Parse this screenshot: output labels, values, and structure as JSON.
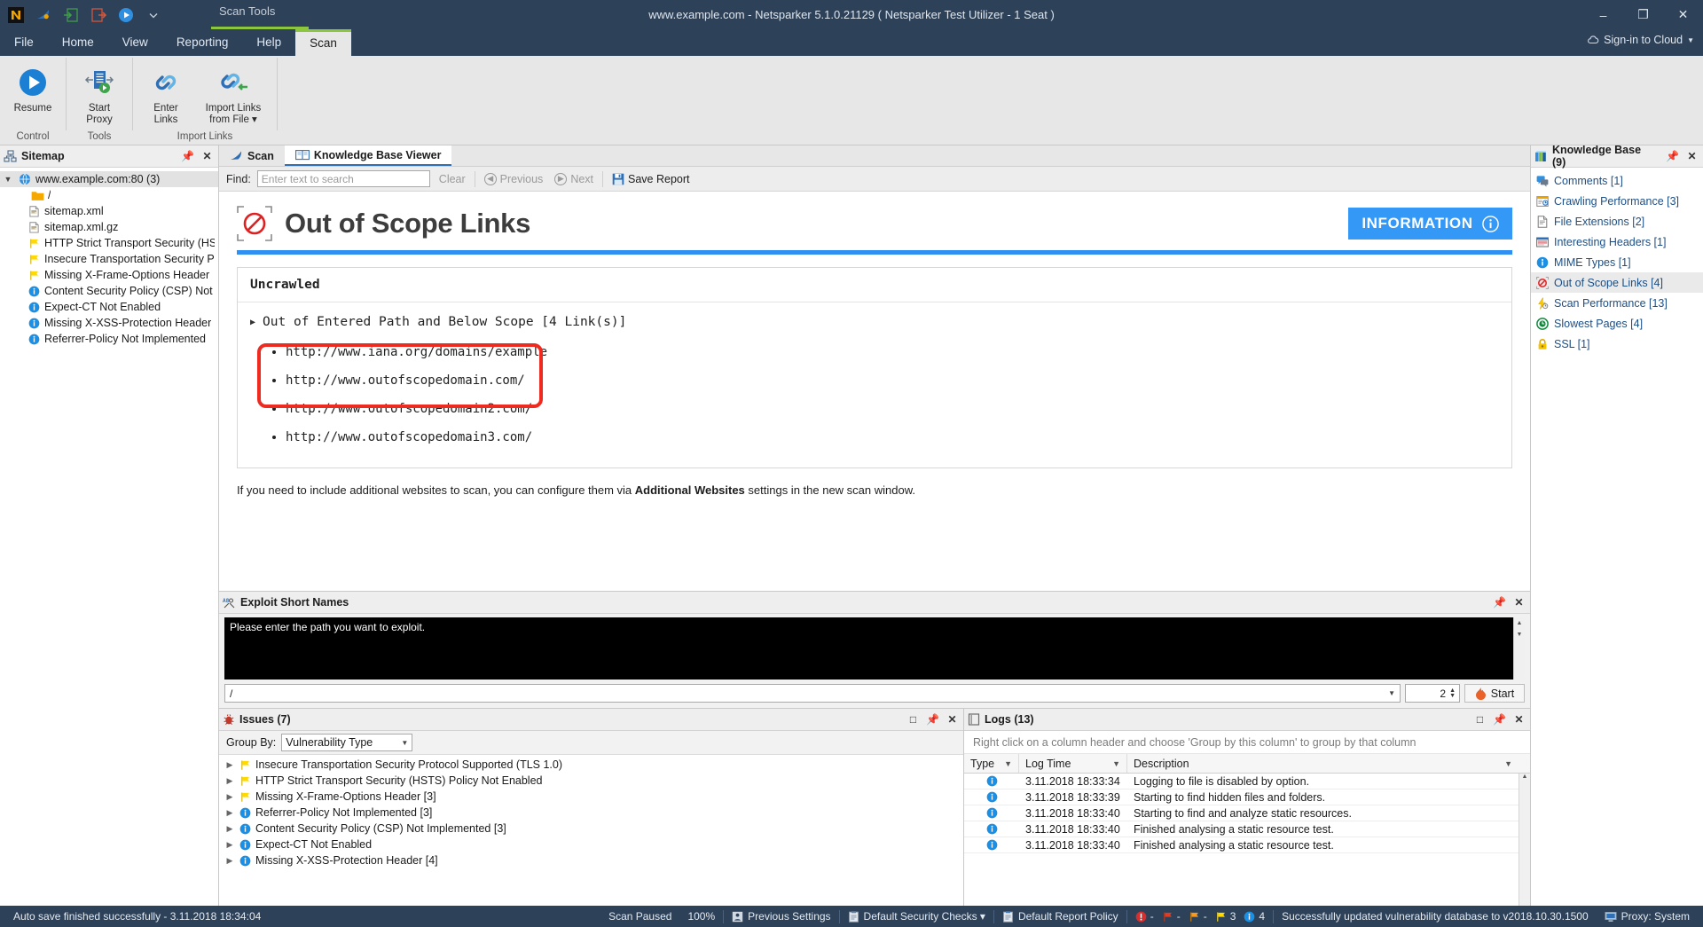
{
  "window": {
    "title": "www.example.com - Netsparker 5.1.0.21129  ( Netsparker Test Utilizer - 1 Seat )",
    "contextual_tab_group": "Scan Tools",
    "minimize": "–",
    "restore": "❐",
    "close": "✕",
    "cloud_signin": "Sign-in to Cloud"
  },
  "ribbon": {
    "tabs": [
      {
        "label": "File",
        "active": false
      },
      {
        "label": "Home",
        "active": false
      },
      {
        "label": "View",
        "active": false
      },
      {
        "label": "Reporting",
        "active": false
      },
      {
        "label": "Help",
        "active": false
      },
      {
        "label": "Scan",
        "active": true
      }
    ],
    "groups": [
      {
        "label": "Control",
        "buttons": [
          {
            "label": "Resume",
            "icon": "play-circle-icon"
          }
        ]
      },
      {
        "label": "Tools",
        "buttons": [
          {
            "label": "Start\nProxy",
            "icon": "proxy-icon"
          }
        ]
      },
      {
        "label": "Import Links",
        "buttons": [
          {
            "label": "Enter\nLinks",
            "icon": "chain-link-icon"
          },
          {
            "label": "Import Links\nfrom File ▾",
            "icon": "import-link-icon"
          }
        ]
      }
    ]
  },
  "sitemap": {
    "title": "Sitemap",
    "root": {
      "label": "www.example.com:80 (3)",
      "icon": "globe-icon"
    },
    "items": [
      {
        "label": "/",
        "icon": "folder-icon"
      },
      {
        "label": "sitemap.xml",
        "icon": "xml-file-icon"
      },
      {
        "label": "sitemap.xml.gz",
        "icon": "xml-file-icon"
      },
      {
        "label": "HTTP Strict Transport Security (HST",
        "icon": "flag-yellow-icon"
      },
      {
        "label": "Insecure Transportation Security Pr",
        "icon": "flag-yellow-icon"
      },
      {
        "label": "Missing X-Frame-Options Header",
        "icon": "flag-yellow-icon"
      },
      {
        "label": "Content Security Policy (CSP) Not I",
        "icon": "info-blue-icon"
      },
      {
        "label": "Expect-CT Not Enabled",
        "icon": "info-blue-icon"
      },
      {
        "label": "Missing X-XSS-Protection Header",
        "icon": "info-blue-icon"
      },
      {
        "label": "Referrer-Policy Not Implemented",
        "icon": "info-blue-icon"
      }
    ]
  },
  "doc_tabs": [
    {
      "label": "Scan",
      "icon": "shark-fin-icon",
      "active": false
    },
    {
      "label": "Knowledge Base Viewer",
      "icon": "book-icon",
      "active": true
    }
  ],
  "findbar": {
    "find_label": "Find:",
    "placeholder": "Enter text to search",
    "value": "",
    "clear": "Clear",
    "previous": "Previous",
    "next": "Next",
    "save_report": "Save Report"
  },
  "kb_view": {
    "icon": "no-entry-icon",
    "title": "Out of Scope Links",
    "severity_badge": "INFORMATION",
    "card_title": "Uncrawled",
    "group_label": "Out of Entered Path and Below Scope [4 Link(s)]",
    "links": [
      "http://www.iana.org/domains/example",
      "http://www.outofscopedomain.com/",
      "http://www.outofscopedomain2.com/",
      "http://www.outofscopedomain3.com/"
    ],
    "note_before": "If you need to include additional websites to scan, you can configure them via ",
    "note_bold": "Additional Websites",
    "note_after": " settings in the new scan window.",
    "highlight_color": "#ee2b21"
  },
  "exploit": {
    "title": "Exploit Short Names",
    "terminal_text": "Please enter the path you want to exploit.",
    "path_value": "/",
    "threads_value": "2",
    "start_label": "Start"
  },
  "issues": {
    "title": "Issues (7)",
    "group_by_label": "Group By:",
    "group_by_value": "Vulnerability Type",
    "rows": [
      {
        "label": "Insecure Transportation Security Protocol Supported (TLS 1.0)",
        "icon": "flag-yellow-icon"
      },
      {
        "label": "HTTP Strict Transport Security (HSTS) Policy Not Enabled",
        "icon": "flag-yellow-icon"
      },
      {
        "label": "Missing X-Frame-Options Header [3]",
        "icon": "flag-yellow-icon"
      },
      {
        "label": "Referrer-Policy Not Implemented [3]",
        "icon": "info-blue-icon"
      },
      {
        "label": "Content Security Policy (CSP) Not Implemented [3]",
        "icon": "info-blue-icon"
      },
      {
        "label": "Expect-CT Not Enabled",
        "icon": "info-blue-icon"
      },
      {
        "label": "Missing X-XSS-Protection Header [4]",
        "icon": "info-blue-icon"
      }
    ]
  },
  "logs": {
    "title": "Logs (13)",
    "hint": "Right click on a column header and choose 'Group by this column' to group by that column",
    "columns": [
      "Type",
      "Log Time",
      "Description"
    ],
    "rows": [
      {
        "type": "info-blue-icon",
        "time": "3.11.2018 18:33:34",
        "desc": "Logging to file is disabled by option."
      },
      {
        "type": "info-blue-icon",
        "time": "3.11.2018 18:33:39",
        "desc": "Starting to find hidden files and folders."
      },
      {
        "type": "info-blue-icon",
        "time": "3.11.2018 18:33:40",
        "desc": "Starting to find and analyze static resources."
      },
      {
        "type": "info-blue-icon",
        "time": "3.11.2018 18:33:40",
        "desc": "Finished analysing a static resource test."
      },
      {
        "type": "info-blue-icon",
        "time": "3.11.2018 18:33:40",
        "desc": "Finished analysing a static resource test."
      }
    ]
  },
  "knowledge_base": {
    "title": "Knowledge Base (9)",
    "items": [
      {
        "label": "Comments [1]",
        "icon": "comments-icon",
        "selected": false
      },
      {
        "label": "Crawling Performance [3]",
        "icon": "crawl-perf-icon",
        "selected": false
      },
      {
        "label": "File Extensions [2]",
        "icon": "file-icon",
        "selected": false
      },
      {
        "label": "Interesting Headers [1]",
        "icon": "headers-icon",
        "selected": false
      },
      {
        "label": "MIME Types [1]",
        "icon": "info-blue-icon",
        "selected": false
      },
      {
        "label": "Out of Scope Links [4]",
        "icon": "no-entry-icon",
        "selected": true
      },
      {
        "label": "Scan Performance [13]",
        "icon": "bolt-icon",
        "selected": false
      },
      {
        "label": "Slowest Pages [4]",
        "icon": "clock-icon",
        "selected": false
      },
      {
        "label": "SSL [1]",
        "icon": "lock-icon",
        "selected": false
      }
    ]
  },
  "statusbar": {
    "autosave": "Auto save finished successfully - 3.11.2018 18:34:04",
    "scan_state": "Scan Paused",
    "progress": "100%",
    "previous_settings": "Previous Settings",
    "security_checks": "Default Security Checks ▾",
    "report_policy": "Default Report Policy",
    "counts": [
      {
        "icon": "critical-icon",
        "value": "-"
      },
      {
        "icon": "flag-red-icon",
        "value": "-"
      },
      {
        "icon": "flag-orange-icon",
        "value": "-"
      },
      {
        "icon": "flag-yellow-icon",
        "value": "3"
      },
      {
        "icon": "info-blue-icon",
        "value": "4"
      }
    ],
    "db_message": "Successfully updated vulnerability database to v2018.10.30.1500",
    "proxy": "Proxy: System"
  }
}
